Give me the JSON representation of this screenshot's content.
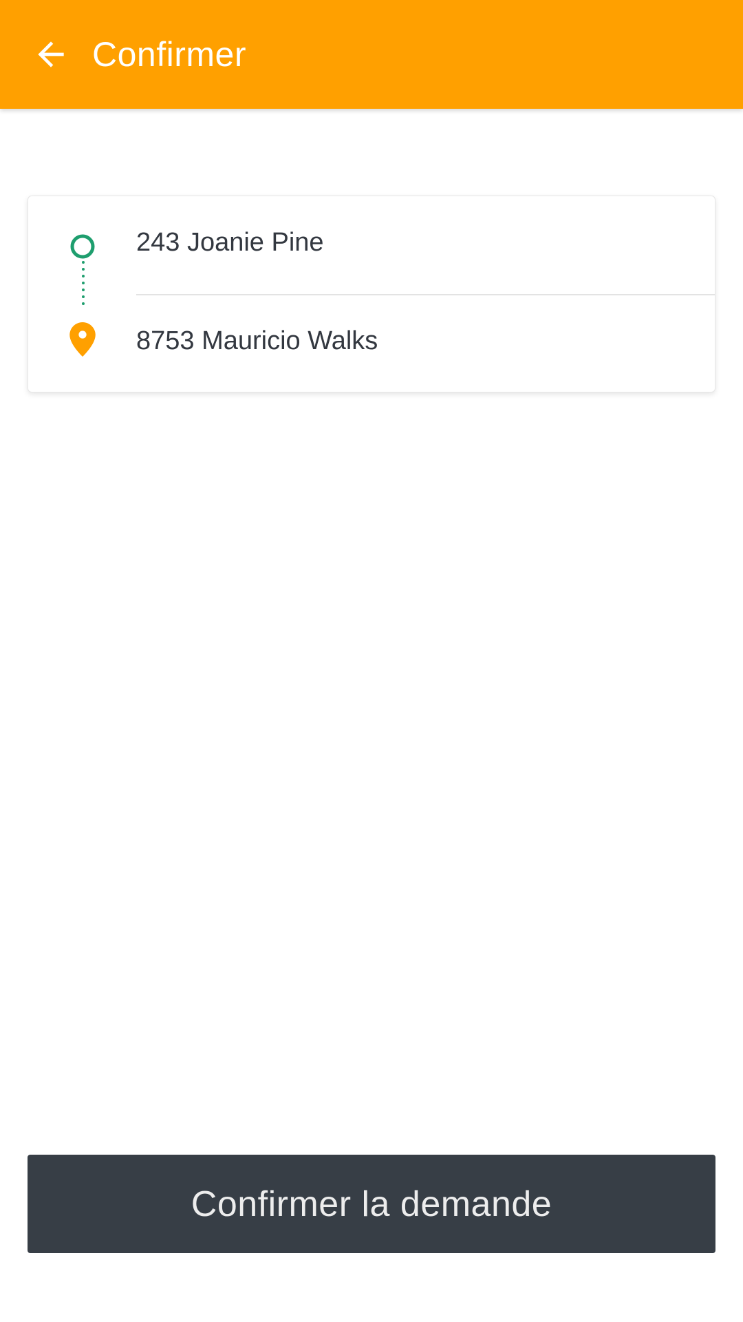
{
  "app_bar": {
    "title": "Confirmer",
    "background_color": "#FFA000",
    "back_icon": "arrow-left-icon"
  },
  "route": {
    "origin": {
      "address": "243 Joanie Pine",
      "icon": "origin-circle-icon",
      "color": "#1E9E6E"
    },
    "destination": {
      "address": "8753 Mauricio Walks",
      "icon": "destination-pin-icon",
      "color": "#FFA000"
    }
  },
  "confirm_button": {
    "label": "Confirmer la demande",
    "background_color": "#373E46"
  }
}
